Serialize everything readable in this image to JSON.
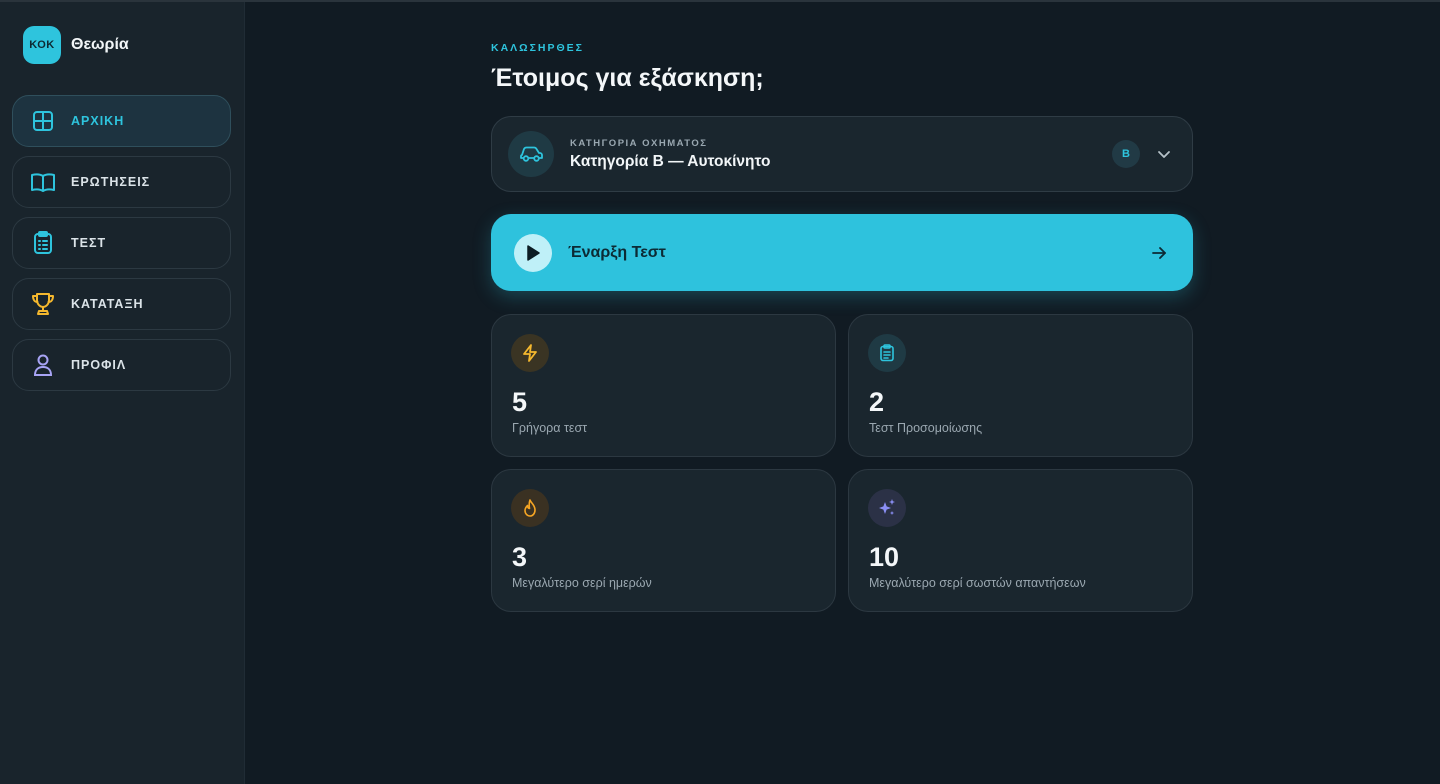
{
  "brand": {
    "logo_text": "ΚΟΚ",
    "name": "Θεωρία"
  },
  "sidebar": {
    "items": [
      {
        "label": "ΑΡΧΙΚΗ",
        "icon": "grid-icon",
        "active": true
      },
      {
        "label": "ΕΡΩΤΗΣΕΙΣ",
        "icon": "book-icon",
        "active": false
      },
      {
        "label": "ΤΕΣΤ",
        "icon": "clipboard-icon",
        "active": false
      },
      {
        "label": "ΚΑΤΑΤΑΞΗ",
        "icon": "trophy-icon",
        "active": false
      },
      {
        "label": "ΠΡΟΦΙΛ",
        "icon": "user-icon",
        "active": false
      }
    ]
  },
  "header": {
    "eyebrow": "ΚΑΛΩΣΗΡΘΕΣ",
    "title": "Έτοιμος για εξάσκηση;"
  },
  "category": {
    "label": "ΚΑΤΗΓΟΡΙΑ ΟΧΗΜΑΤΟΣ",
    "value": "Κατηγορία Β — Αυτοκίνητο",
    "badge": "B",
    "icon": "car-icon"
  },
  "start": {
    "label": "Έναρξη Τεστ",
    "icon": "play-icon"
  },
  "stats": [
    {
      "value": "5",
      "label": "Γρήγορα τεστ",
      "icon": "lightning-icon",
      "color": "#f5b82e"
    },
    {
      "value": "2",
      "label": "Τεστ Προσομοίωσης",
      "icon": "clipboard-icon",
      "color": "#2ec4dd"
    },
    {
      "value": "3",
      "label": "Μεγαλύτερο σερί ημερών",
      "icon": "flame-icon",
      "color": "#f5a524"
    },
    {
      "value": "10",
      "label": "Μεγαλύτερο σερί σωστών απαντήσεων",
      "icon": "sparkles-icon",
      "color": "#8b8ff5"
    }
  ],
  "colors": {
    "accent": "#2ec4dd",
    "background": "#111b23",
    "sidebar": "#19242c",
    "card": "#1a262e"
  }
}
